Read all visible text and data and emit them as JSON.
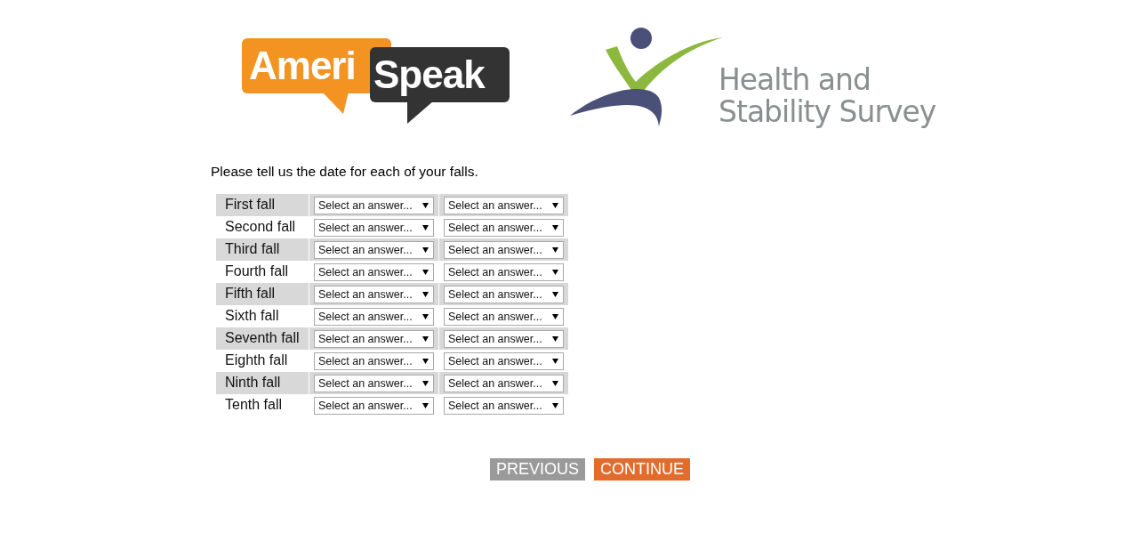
{
  "logos": {
    "amerispeak": {
      "part_1": "Ameri",
      "part_2": "Speak"
    },
    "survey": {
      "line_1": "Health and",
      "line_2": "Stability Survey"
    }
  },
  "question": "Please tell us the date for each of your falls.",
  "rows": [
    {
      "label": "First fall",
      "selects": [
        "Select an answer...",
        "Select an answer..."
      ]
    },
    {
      "label": "Second fall",
      "selects": [
        "Select an answer...",
        "Select an answer..."
      ]
    },
    {
      "label": "Third fall",
      "selects": [
        "Select an answer...",
        "Select an answer..."
      ]
    },
    {
      "label": "Fourth fall",
      "selects": [
        "Select an answer...",
        "Select an answer..."
      ]
    },
    {
      "label": "Fifth fall",
      "selects": [
        "Select an answer...",
        "Select an answer..."
      ]
    },
    {
      "label": "Sixth fall",
      "selects": [
        "Select an answer...",
        "Select an answer..."
      ]
    },
    {
      "label": "Seventh fall",
      "selects": [
        "Select an answer...",
        "Select an answer..."
      ]
    },
    {
      "label": "Eighth fall",
      "selects": [
        "Select an answer...",
        "Select an answer..."
      ]
    },
    {
      "label": "Ninth fall",
      "selects": [
        "Select an answer...",
        "Select an answer..."
      ]
    },
    {
      "label": "Tenth fall",
      "selects": [
        "Select an answer...",
        "Select an answer..."
      ]
    }
  ],
  "buttons": [
    {
      "label": "PREVIOUS",
      "kind": "secondary"
    },
    {
      "label": "CONTINUE",
      "kind": "primary"
    }
  ]
}
